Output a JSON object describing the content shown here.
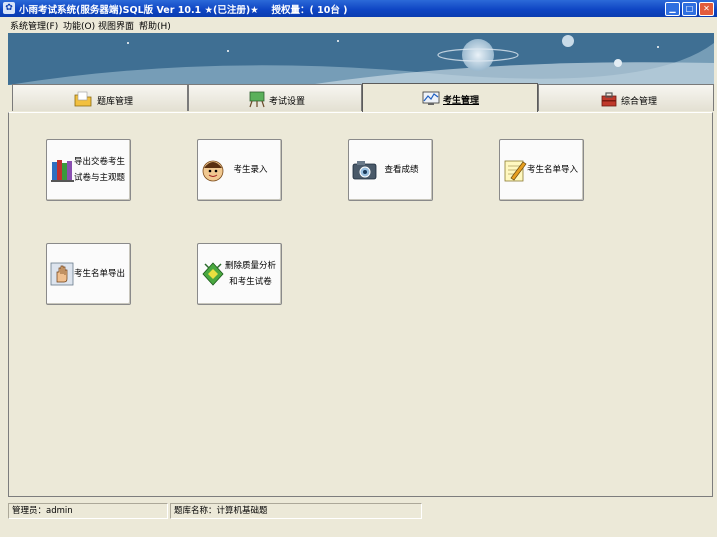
{
  "window": {
    "title": "小雨考试系统(服务器端)SQL版 Ver 10.1 ★(已注册)★　 授权量：( 10台 )"
  },
  "menu": {
    "items": [
      {
        "label": "系统管理(F)"
      },
      {
        "label": "功能(O)"
      },
      {
        "label": "视图界面"
      },
      {
        "label": "帮助(H)"
      }
    ]
  },
  "tabs": [
    {
      "label": "题库管理",
      "icon": "folder-icon",
      "active": false
    },
    {
      "label": "考试设置",
      "icon": "easel-icon",
      "active": false
    },
    {
      "label": "考生管理",
      "icon": "monitor-chart-icon",
      "active": true
    },
    {
      "label": "综合管理",
      "icon": "toolbox-icon",
      "active": false
    }
  ],
  "buttons": [
    {
      "line1": "导出交卷考生",
      "line2": "试卷与主观题",
      "icon": "books-icon"
    },
    {
      "line1": "考生录入",
      "line2": "",
      "icon": "face-icon"
    },
    {
      "line1": "查看成绩",
      "line2": "",
      "icon": "camera-icon"
    },
    {
      "line1": "考生名单导入",
      "line2": "",
      "icon": "pencil-note-icon"
    },
    {
      "line1": "考生名单导出",
      "line2": "",
      "icon": "hand-icon"
    },
    {
      "line1": "删除质量分析",
      "line2": "和考生试卷",
      "icon": "recycle-icon"
    }
  ],
  "status": {
    "admin": "管理员：admin",
    "bank": "题库名称：计算机基础题"
  },
  "colors": {
    "titlebar": "#0f46c4",
    "background": "#ece9d8"
  }
}
